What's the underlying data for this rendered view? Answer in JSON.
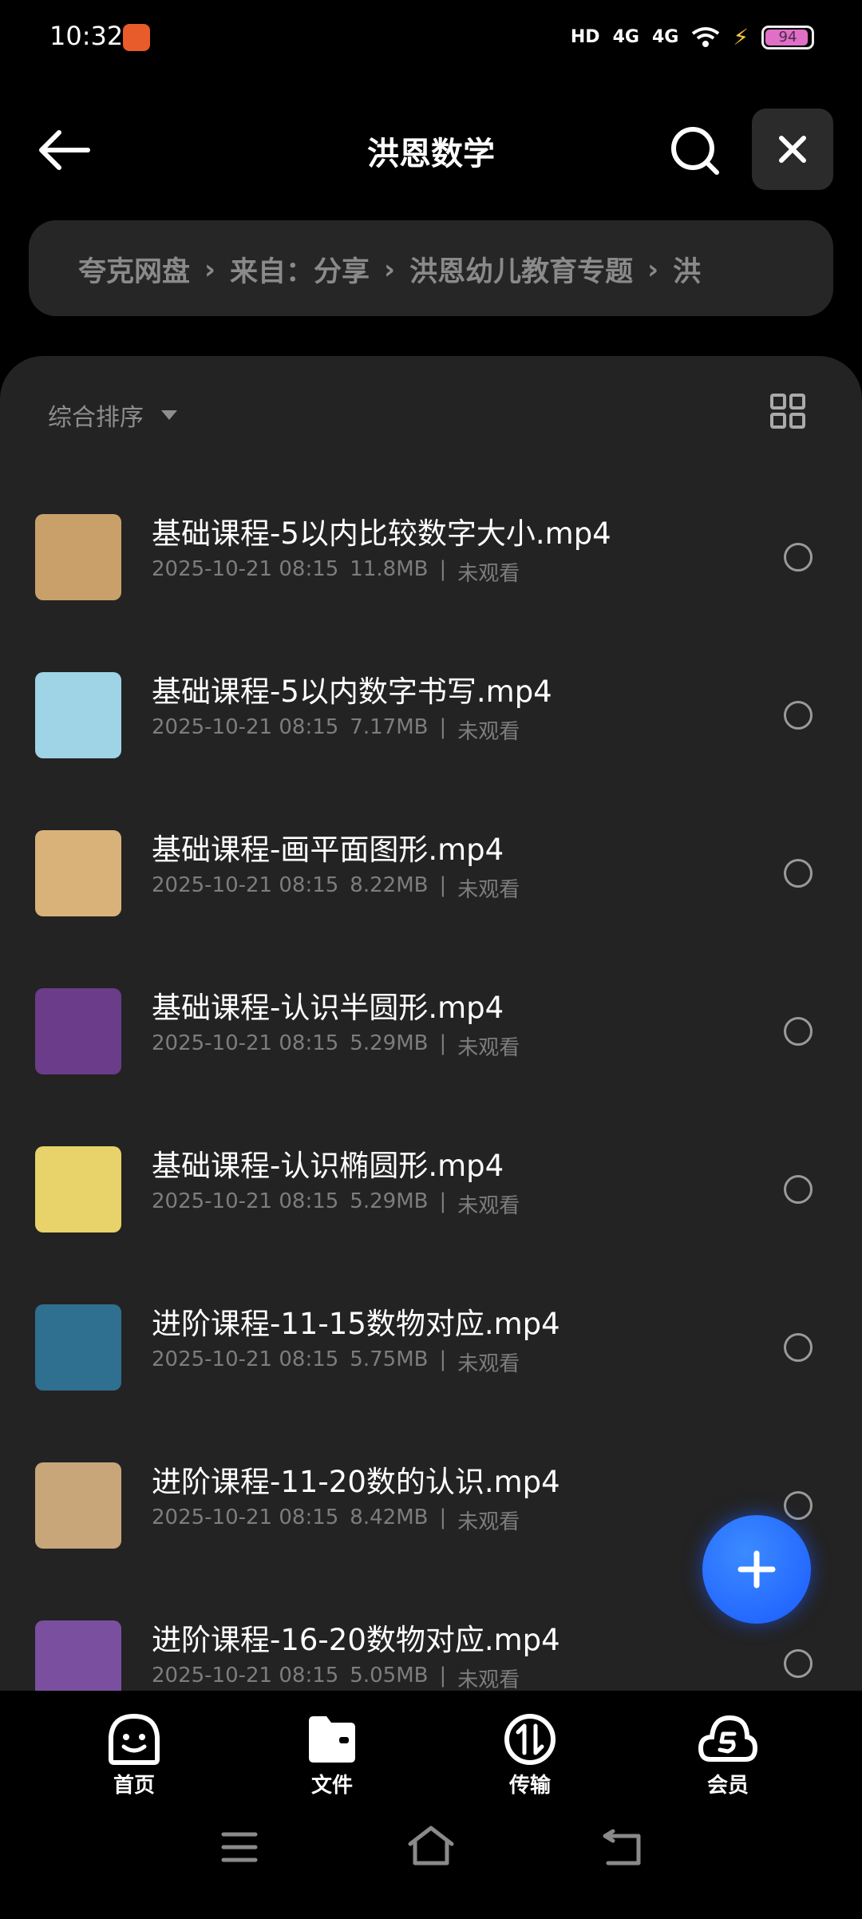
{
  "status": {
    "time": "10:32",
    "net1": "4G",
    "net2": "4G",
    "hd": "HD",
    "battery": "94"
  },
  "header": {
    "title": "洪恩数学"
  },
  "breadcrumb": [
    "夸克网盘",
    "来自：分享",
    "洪恩幼儿教育专题",
    "洪"
  ],
  "sort": {
    "label": "综合排序"
  },
  "files": [
    {
      "name": "基础课程-5以内比较数字大小.mp4",
      "date": "2025-10-21 08:15",
      "size": "11.8MB",
      "status": "未观看",
      "thumb": "#c9a06a"
    },
    {
      "name": "基础课程-5以内数字书写.mp4",
      "date": "2025-10-21 08:15",
      "size": "7.17MB",
      "status": "未观看",
      "thumb": "#9fd3e6"
    },
    {
      "name": "基础课程-画平面图形.mp4",
      "date": "2025-10-21 08:15",
      "size": "8.22MB",
      "status": "未观看",
      "thumb": "#d9b27a"
    },
    {
      "name": "基础课程-认识半圆形.mp4",
      "date": "2025-10-21 08:15",
      "size": "5.29MB",
      "status": "未观看",
      "thumb": "#6b3c8a"
    },
    {
      "name": "基础课程-认识椭圆形.mp4",
      "date": "2025-10-21 08:15",
      "size": "5.29MB",
      "status": "未观看",
      "thumb": "#e8d26a"
    },
    {
      "name": "进阶课程-11-15数物对应.mp4",
      "date": "2025-10-21 08:15",
      "size": "5.75MB",
      "status": "未观看",
      "thumb": "#2f6f8f"
    },
    {
      "name": "进阶课程-11-20数的认识.mp4",
      "date": "2025-10-21 08:15",
      "size": "8.42MB",
      "status": "未观看",
      "thumb": "#c9a57a"
    },
    {
      "name": "进阶课程-16-20数物对应.mp4",
      "date": "2025-10-21 08:15",
      "size": "5.05MB",
      "status": "未观看",
      "thumb": "#7a4fa0"
    }
  ],
  "tabs": [
    {
      "label": "首页",
      "icon": "smile-icon"
    },
    {
      "label": "文件",
      "icon": "folder-icon"
    },
    {
      "label": "传输",
      "icon": "transfer-icon"
    },
    {
      "label": "会员",
      "icon": "cloud-s-icon"
    }
  ]
}
